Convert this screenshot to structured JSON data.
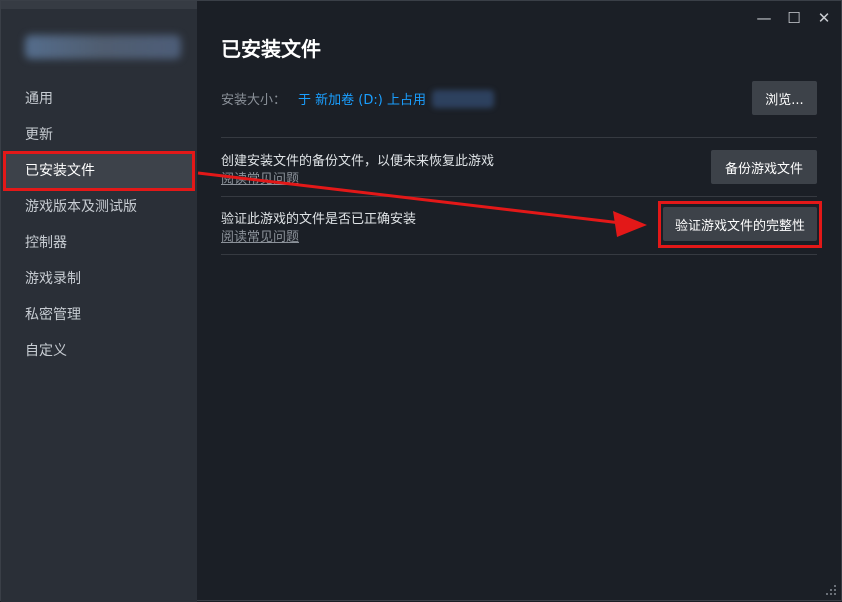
{
  "window": {
    "controls": {
      "minimize": "—",
      "maximize": "☐",
      "close": "✕"
    }
  },
  "sidebar": {
    "items": [
      {
        "label": "通用"
      },
      {
        "label": "更新"
      },
      {
        "label": "已安装文件",
        "active": true
      },
      {
        "label": "游戏版本及测试版"
      },
      {
        "label": "控制器"
      },
      {
        "label": "游戏录制"
      },
      {
        "label": "私密管理"
      },
      {
        "label": "自定义"
      }
    ]
  },
  "main": {
    "title": "已安装文件",
    "install_size": {
      "label": "安装大小：",
      "value": "于 新加卷 (D:) 上占用"
    },
    "browse_label": "浏览...",
    "backup": {
      "description": "创建安装文件的备份文件，以便未来恢复此游戏",
      "faq_link": "阅读常见问题",
      "button_label": "备份游戏文件"
    },
    "verify": {
      "description": "验证此游戏的文件是否已正确安装",
      "faq_link": "阅读常见问题",
      "button_label": "验证游戏文件的完整性"
    }
  },
  "colors": {
    "accent_link": "#1a9fff",
    "highlight": "#e31818",
    "sidebar_bg": "#2a2f37",
    "main_bg": "#1b1f26"
  }
}
